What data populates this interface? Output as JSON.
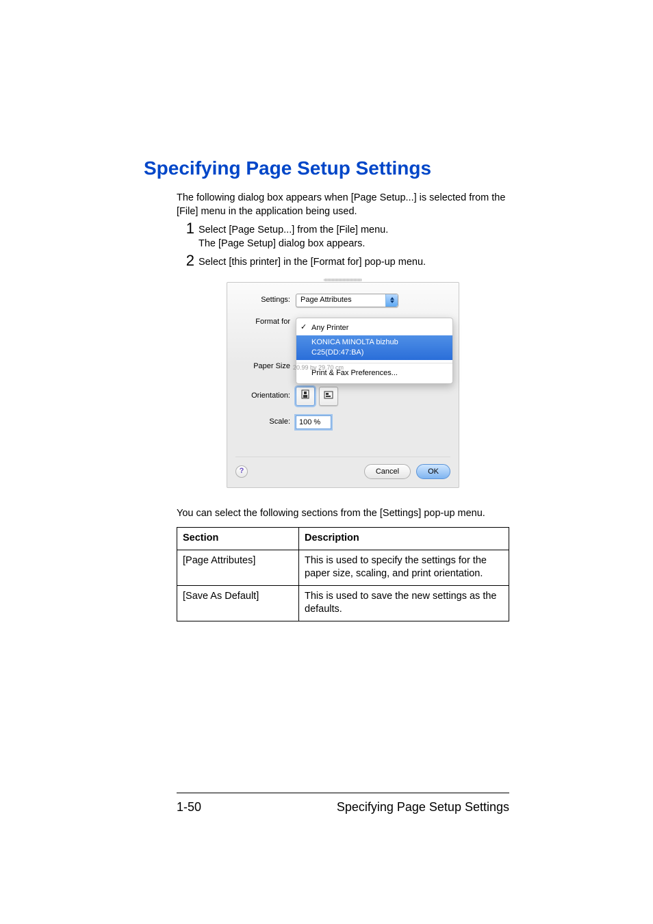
{
  "heading": "Specifying Page Setup Settings",
  "intro": "The following dialog box appears when [Page Setup...] is selected from the [File] menu in the application being used.",
  "steps": [
    {
      "num": "1",
      "lines": [
        "Select [Page Setup...] from the [File] menu.",
        "The [Page Setup] dialog box appears."
      ]
    },
    {
      "num": "2",
      "lines": [
        "Select [this printer] in the [Format for] pop-up menu."
      ]
    }
  ],
  "dialog": {
    "labels": {
      "settings": "Settings:",
      "format_for": "Format for",
      "paper_size": "Paper Size",
      "orientation": "Orientation:",
      "scale": "Scale:"
    },
    "settings_popup": {
      "value": "Page Attributes"
    },
    "format_for_menu": {
      "items": [
        {
          "label": "Any Printer",
          "checked": true,
          "highlight": false
        },
        {
          "label": "KONICA MINOLTA bizhub C25(DD:47:BA)",
          "checked": false,
          "highlight": true
        },
        {
          "sep": true
        },
        {
          "label": "Print & Fax Preferences...",
          "checked": false,
          "highlight": false
        }
      ]
    },
    "paper_size_sub": "20.99 by 29.70 cm",
    "scale_value": "100 %",
    "buttons": {
      "cancel": "Cancel",
      "ok": "OK"
    }
  },
  "after_text": "You can select the following sections from the [Settings] pop-up menu.",
  "table": {
    "headers": {
      "section": "Section",
      "description": "Description"
    },
    "rows": [
      {
        "section": "[Page Attributes]",
        "description": "This is used to specify the settings for the paper size, scaling, and print orientation."
      },
      {
        "section": "[Save As Default]",
        "description": "This is used to save the new settings as the defaults."
      }
    ]
  },
  "footer": {
    "page_num": "1-50",
    "title": "Specifying Page Setup Settings"
  }
}
